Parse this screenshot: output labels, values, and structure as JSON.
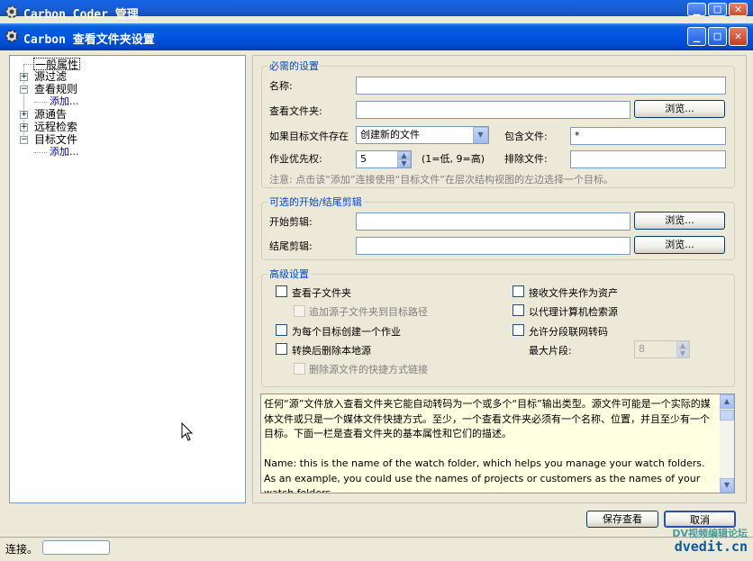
{
  "back_window": {
    "title": "Carbon Coder 管理"
  },
  "window": {
    "title": "Carbon 查看文件夹设置"
  },
  "tree": {
    "general": "一般属性",
    "source_filter": "源过滤",
    "view_rules": "查看规则",
    "view_rules_add": "添加...",
    "source_notice": "源通告",
    "remote_search": "远程检索",
    "target_files": "目标文件",
    "target_files_add": "添加..."
  },
  "required": {
    "legend": "必需的设置",
    "name_label": "名称:",
    "name_value": "",
    "folder_label": "查看文件夹:",
    "folder_value": "",
    "browse": "浏览...",
    "exists_label": "如果目标文件存在",
    "exists_value": "创建新的文件",
    "include_label": "包含文件:",
    "include_value": "*",
    "priority_label": "作业优先权:",
    "priority_value": "5",
    "priority_hint": "(1=低, 9=高)",
    "exclude_label": "排除文件:",
    "exclude_value": "",
    "note": "注意: 点击该“添加”连接使用“目标文件”在层次结构视图的左边选择一个目标。"
  },
  "clips": {
    "legend": "可选的开始/结尾剪辑",
    "start_label": "开始剪辑:",
    "start_value": "",
    "end_label": "结尾剪辑:",
    "end_value": "",
    "browse": "浏览..."
  },
  "advanced": {
    "legend": "高级设置",
    "watch_subfolders": "查看子文件夹",
    "append_source_subfolder": "追加源子文件夹到目标路径",
    "job_per_target": "为每个目标创建一个作业",
    "delete_local_source": "转换后删除本地源",
    "delete_source_shortcut": "删除源文件的快捷方式链接",
    "receive_as_assets": "接收文件夹作为资产",
    "proxy_search_source": "以代理计算机检索源",
    "allow_segment_transcode": "允许分段联网转码",
    "max_segments_label": "最大片段:",
    "max_segments_value": "8"
  },
  "description": {
    "text": "任何“源”文件放入查看文件夹它能自动转码为一个或多个“目标”输出类型。源文件可能是一个实际的媒体文件或只是一个媒体文件快捷方式。至少，一个查看文件夹必须有一个名称、位置，并且至少有一个目标。下面一栏是查看文件夹的基本属性和它们的描述。\n\nName: this is the name of the watch folder, which helps you manage your watch folders. As an example, you could use the names of projects or customers as the names of your watch folders."
  },
  "buttons": {
    "save": "保存查看",
    "cancel": "取消"
  },
  "status": {
    "text": "连接。"
  },
  "watermark": {
    "line1": "DV视频编辑论坛",
    "line2": "dvedit.cn"
  },
  "colors": {
    "titlebar": "#0054e3",
    "legend": "#0046d5",
    "tree_link": "#00008b",
    "desc_bg": "#ffffe1"
  }
}
